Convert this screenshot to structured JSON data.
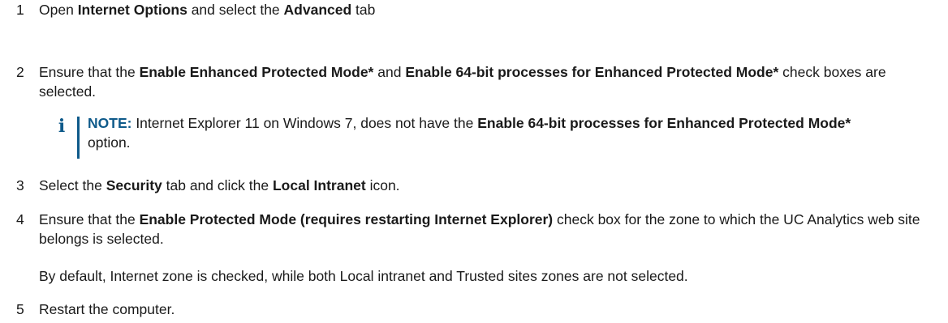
{
  "steps": [
    {
      "num": "1",
      "t1": "Open ",
      "b1": "Internet Options",
      "t2": " and select the ",
      "b2": "Advanced",
      "t3": " tab"
    },
    {
      "num": "2",
      "t1": "Ensure that the ",
      "b1": "Enable Enhanced Protected Mode*",
      "t2": " and ",
      "b2": "Enable 64-bit processes for Enhanced Protected Mode*",
      "t3": " check boxes are selected."
    },
    {
      "num": "3",
      "t1": "Select the ",
      "b1": "Security",
      "t2": " tab and click the ",
      "b2": "Local Intranet",
      "t3": " icon."
    },
    {
      "num": "4",
      "t1": "Ensure that the ",
      "b1": "Enable Protected Mode (requires restarting Internet Explorer)",
      "t2": " check box for the zone to which the UC Analytics web site belongs is selected."
    },
    {
      "num": "5",
      "t1": "Restart the computer."
    }
  ],
  "note": {
    "icon": "info-icon",
    "label": "NOTE:",
    "t1": " Internet Explorer 11 on Windows 7, does not have the ",
    "b1": "Enable 64-bit processes for Enhanced Protected Mode*",
    "t2": " option."
  },
  "step4_para": "By default, Internet zone is checked, while both Local intranet and Trusted sites zones are not selected.",
  "colors": {
    "note_accent": "#0e5a8a",
    "text": "#1a1a1a"
  }
}
